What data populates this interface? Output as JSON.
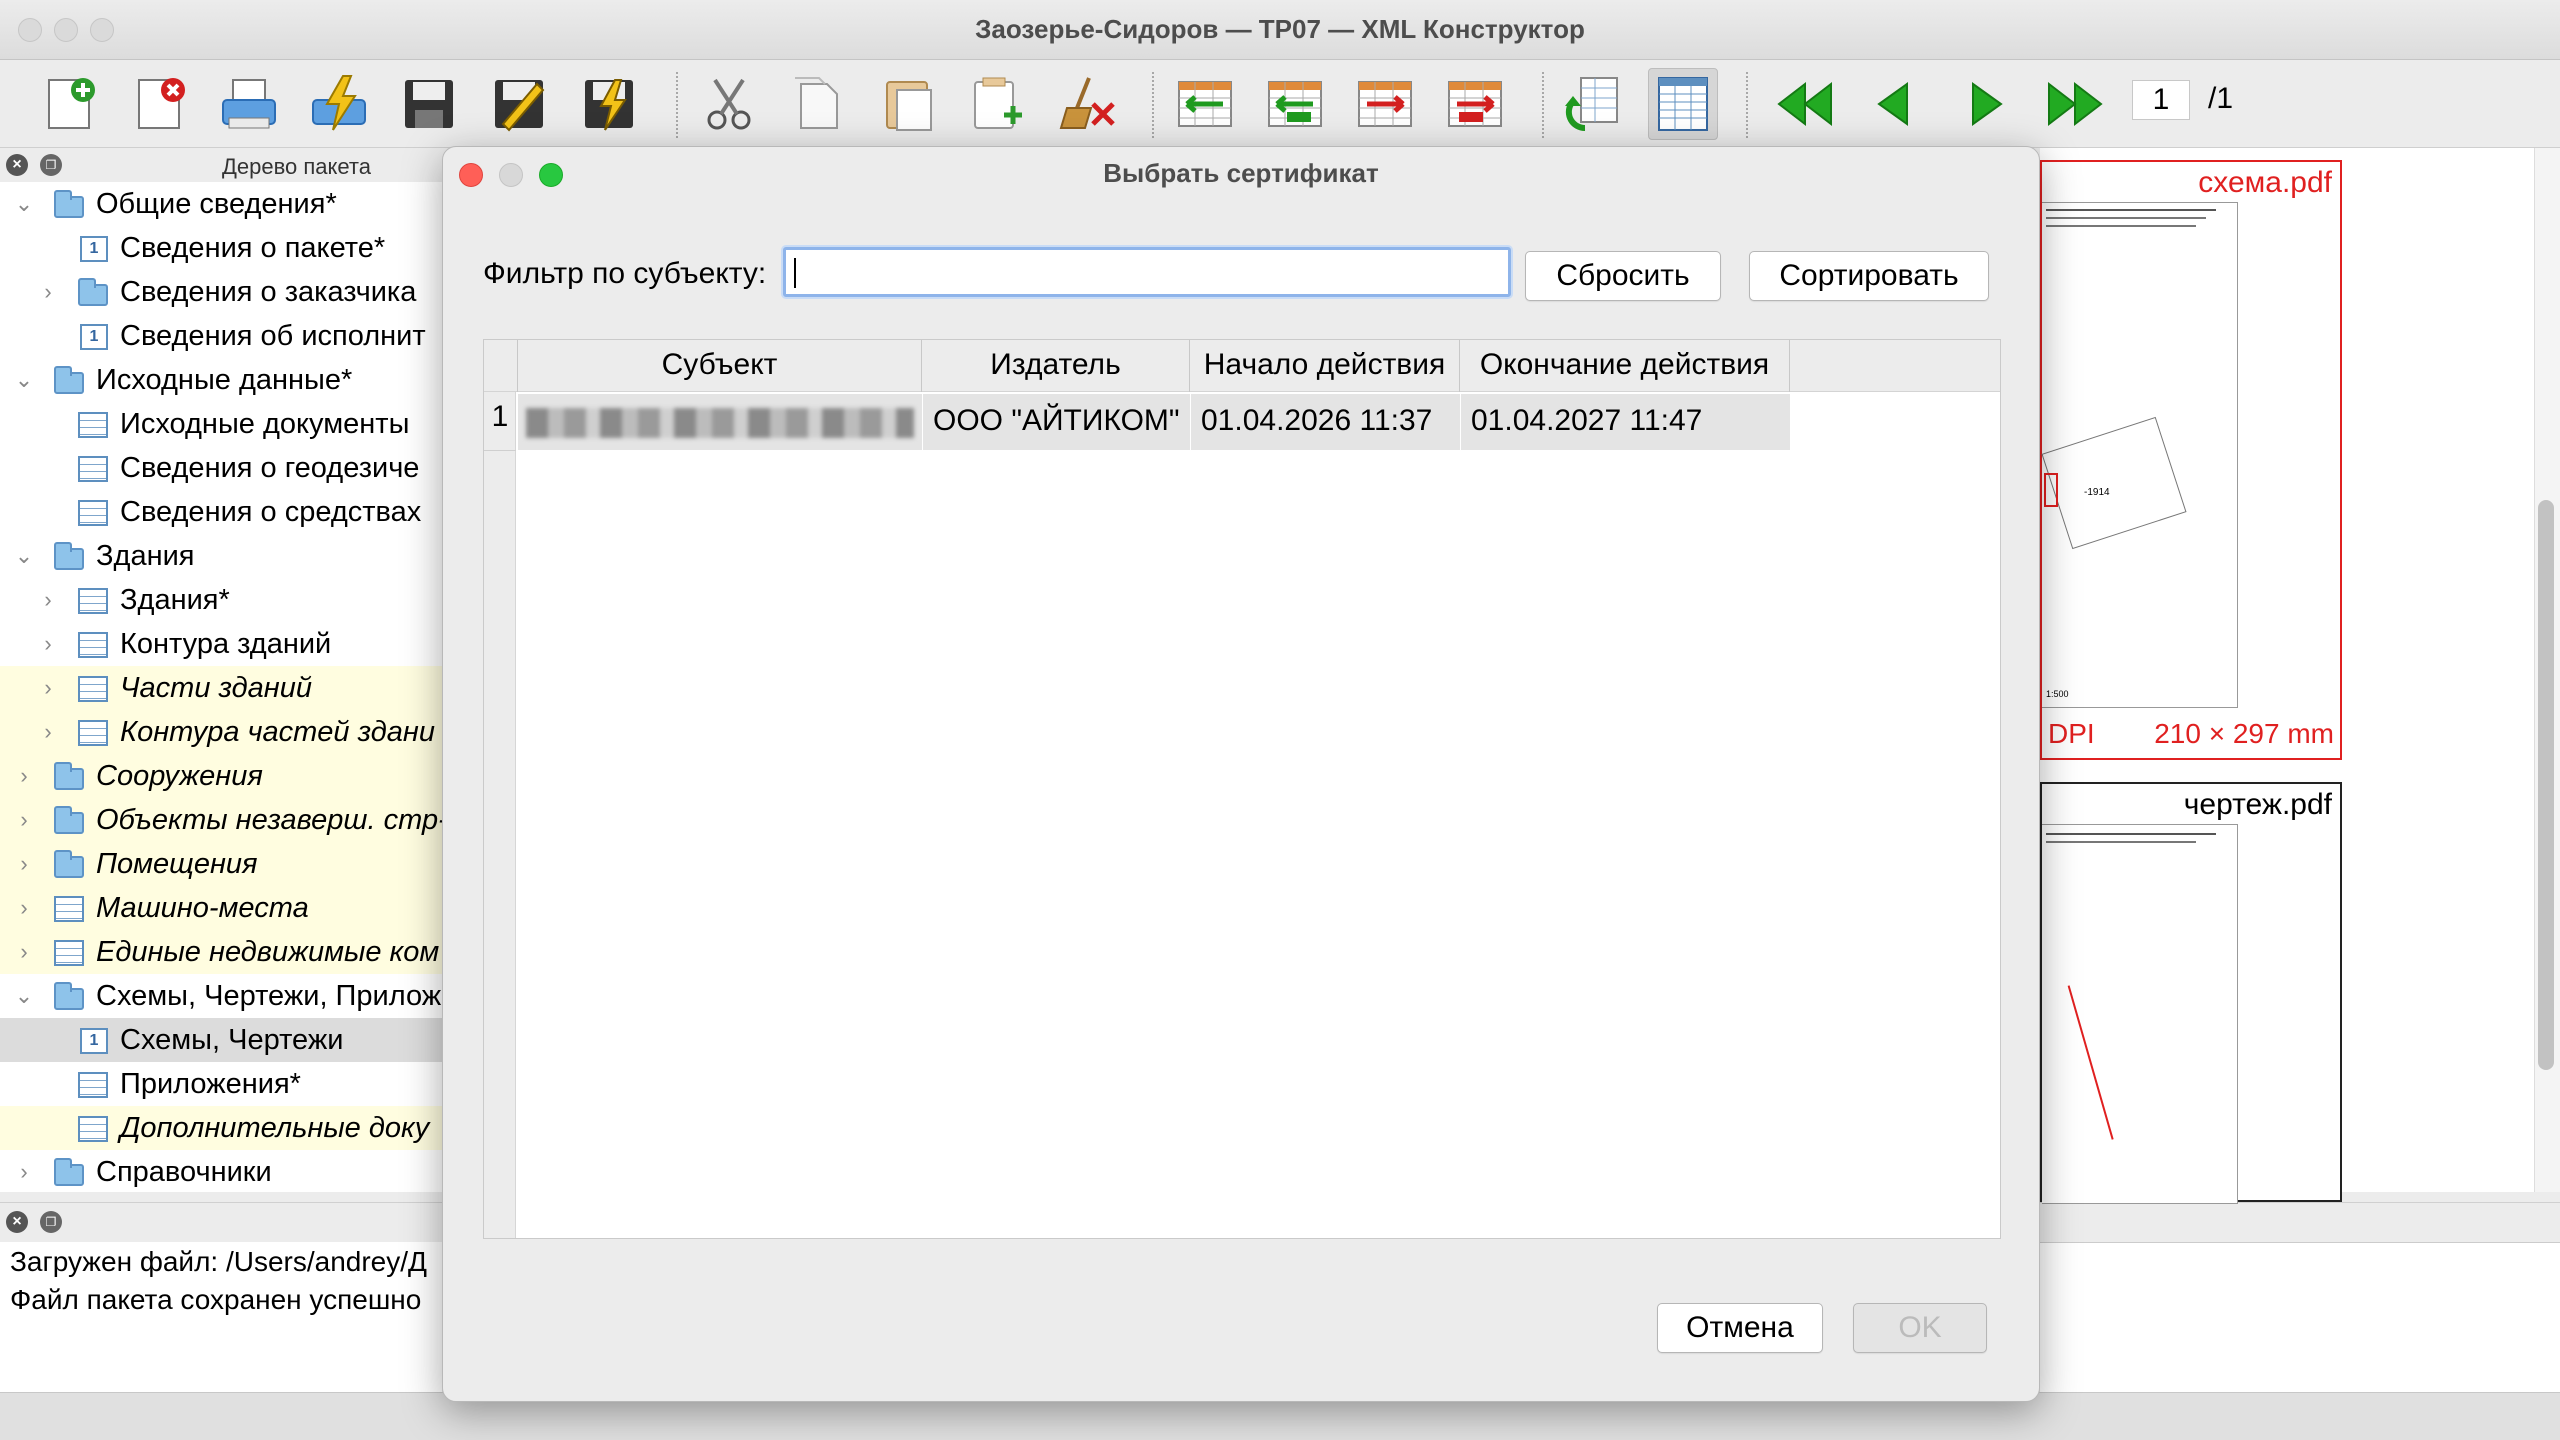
{
  "window": {
    "title": "Заозерье-Сидоров — ТР07 — XML Конструктор"
  },
  "toolbar": {
    "buttons": [
      "new-doc-icon",
      "delete-doc-icon",
      "print-icon",
      "sign-icon",
      "save-icon",
      "edit-sign-icon",
      "validate-sign-icon",
      "cut-icon",
      "copy-icon",
      "paste-icon",
      "paste-new-icon",
      "clear-icon",
      "insert-row-before-icon",
      "insert-row-icon",
      "insert-row-after-icon",
      "delete-row-icon",
      "refresh-icon",
      "table-view-icon",
      "first-page-icon",
      "prev-page-icon",
      "next-page-icon",
      "last-page-icon"
    ],
    "page_current": "1",
    "page_total": "/1"
  },
  "tree_panel": {
    "title": "Дерево пакета",
    "items": [
      {
        "label": "Общие сведения*",
        "level": 0,
        "icon": "folder-icon",
        "expanded": true,
        "style": ""
      },
      {
        "label": "Сведения о пакете*",
        "level": 1,
        "icon": "form-icon",
        "style": ""
      },
      {
        "label": "Сведения о заказчика",
        "level": 1,
        "icon": "folder-icon",
        "collapsed": true,
        "style": ""
      },
      {
        "label": "Сведения об исполнит",
        "level": 1,
        "icon": "form-icon",
        "style": ""
      },
      {
        "label": "Исходные данные*",
        "level": 0,
        "icon": "folder-icon",
        "expanded": true,
        "style": ""
      },
      {
        "label": "Исходные документы",
        "level": 1,
        "icon": "table-icon",
        "style": ""
      },
      {
        "label": "Сведения о геодезиче",
        "level": 1,
        "icon": "table-icon",
        "style": ""
      },
      {
        "label": "Сведения о средствах",
        "level": 1,
        "icon": "table-icon",
        "style": ""
      },
      {
        "label": "Здания",
        "level": 0,
        "icon": "folder-icon",
        "expanded": true,
        "style": ""
      },
      {
        "label": "Здания*",
        "level": 1,
        "icon": "table-icon",
        "collapsed": true,
        "style": ""
      },
      {
        "label": "Контура зданий",
        "level": 1,
        "icon": "table-icon",
        "collapsed": true,
        "style": ""
      },
      {
        "label": "Части зданий",
        "level": 1,
        "icon": "table-icon",
        "collapsed": true,
        "style": "optional"
      },
      {
        "label": "Контура частей здани",
        "level": 1,
        "icon": "table-icon",
        "collapsed": true,
        "style": "optional"
      },
      {
        "label": "Сооружения",
        "level": 0,
        "icon": "folder-icon",
        "collapsed": true,
        "style": "optional"
      },
      {
        "label": "Объекты незаверш. стр-",
        "level": 0,
        "icon": "folder-icon",
        "collapsed": true,
        "style": "optional"
      },
      {
        "label": "Помещения",
        "level": 0,
        "icon": "folder-icon",
        "collapsed": true,
        "style": "optional"
      },
      {
        "label": "Машино-места",
        "level": 0,
        "icon": "table-icon",
        "collapsed": true,
        "style": "optional"
      },
      {
        "label": "Единые недвижимые ком",
        "level": 0,
        "icon": "table-icon",
        "collapsed": true,
        "style": "optional"
      },
      {
        "label": "Схемы, Чертежи, Прилож",
        "level": 0,
        "icon": "folder-icon",
        "expanded": true,
        "style": ""
      },
      {
        "label": "Схемы, Чертежи",
        "level": 1,
        "icon": "form-icon",
        "style": "selected"
      },
      {
        "label": "Приложения*",
        "level": 1,
        "icon": "table-icon",
        "style": ""
      },
      {
        "label": "Дополнительные доку",
        "level": 1,
        "icon": "table-icon",
        "style": "optional"
      },
      {
        "label": "Справочники",
        "level": 0,
        "icon": "folder-icon",
        "collapsed": true,
        "style": ""
      }
    ]
  },
  "log_panel": {
    "lines": [
      "Загружен файл: /Users/andrey/Д",
      "Файл пакета сохранен успешно"
    ]
  },
  "preview": {
    "cards": [
      {
        "name": "схема.pdf",
        "dpi": "DPI",
        "size": "210 × 297 mm",
        "scale": "1:500",
        "label": "-1914"
      },
      {
        "name": "чертеж.pdf"
      }
    ]
  },
  "dialog": {
    "title": "Выбрать сертификат",
    "filter_label": "Фильтр по субъекту:",
    "filter_value": "",
    "reset_button": "Сбросить",
    "sort_button": "Сортировать",
    "columns": [
      "Субъект",
      "Издатель",
      "Начало действия",
      "Окончание действия"
    ],
    "rows": [
      {
        "num": "1",
        "subject": "",
        "issuer": "ООО \"АЙТИКОМ\"",
        "start": "01.04.2026 11:37",
        "end": "01.04.2027 11:47"
      }
    ],
    "cancel_button": "Отмена",
    "ok_button": "OK"
  }
}
